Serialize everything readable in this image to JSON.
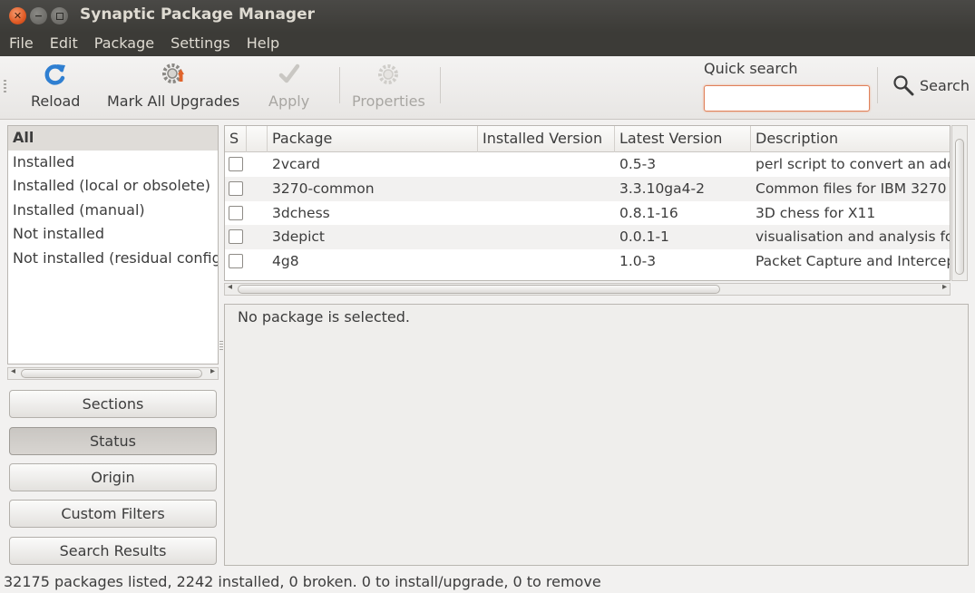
{
  "window": {
    "title": "Synaptic Package Manager"
  },
  "menubar": [
    "File",
    "Edit",
    "Package",
    "Settings",
    "Help"
  ],
  "toolbar": {
    "reload": "Reload",
    "mark_all_upgrades": "Mark All Upgrades",
    "apply": "Apply",
    "properties": "Properties",
    "quick_search_label": "Quick search",
    "quick_search_value": "",
    "search": "Search"
  },
  "filter_list": {
    "items": [
      "All",
      "Installed",
      "Installed (local or obsolete)",
      "Installed (manual)",
      "Not installed",
      "Not installed (residual config"
    ],
    "selected": "All"
  },
  "filter_buttons": {
    "sections": "Sections",
    "status": "Status",
    "origin": "Origin",
    "custom_filters": "Custom Filters",
    "search_results": "Search Results",
    "active": "Status"
  },
  "package_table": {
    "columns": [
      "S",
      "",
      "Package",
      "Installed Version",
      "Latest Version",
      "Description"
    ],
    "rows": [
      {
        "package": "2vcard",
        "installed": "",
        "latest": "0.5-3",
        "description": "perl script to convert an add"
      },
      {
        "package": "3270-common",
        "installed": "",
        "latest": "3.3.10ga4-2",
        "description": "Common files for IBM 3270"
      },
      {
        "package": "3dchess",
        "installed": "",
        "latest": "0.8.1-16",
        "description": "3D chess for X11"
      },
      {
        "package": "3depict",
        "installed": "",
        "latest": "0.0.1-1",
        "description": "visualisation and analysis fo"
      },
      {
        "package": "4g8",
        "installed": "",
        "latest": "1.0-3",
        "description": "Packet Capture and Intercep"
      }
    ]
  },
  "details": {
    "message": "No package is selected."
  },
  "statusbar": {
    "text": "32175 packages listed, 2242 installed, 0 broken. 0 to install/upgrade, 0 to remove"
  }
}
